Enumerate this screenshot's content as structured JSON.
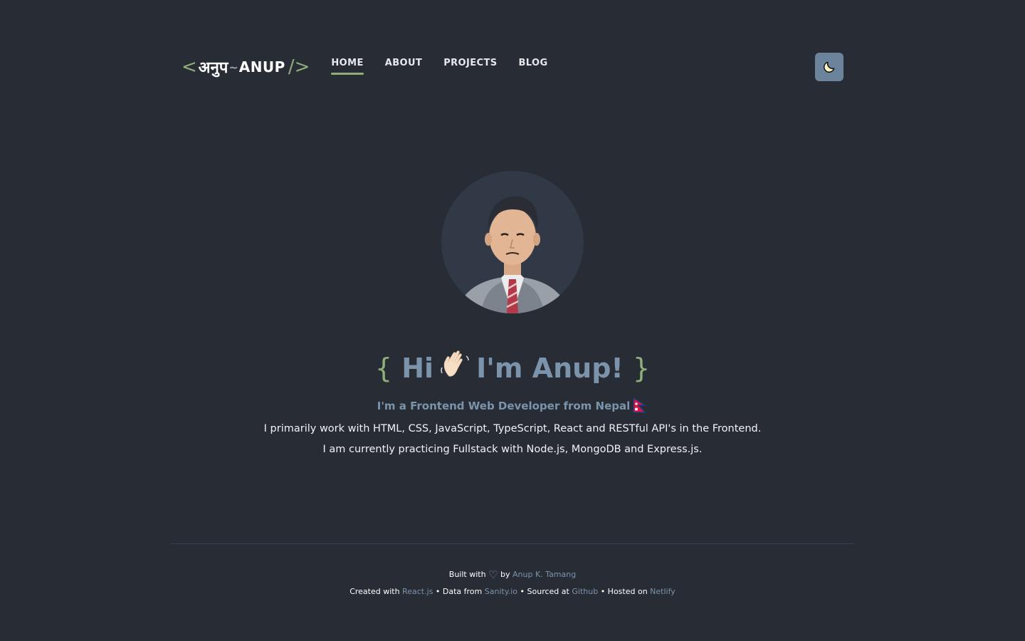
{
  "logo": {
    "open_bracket": "<",
    "devanagari": "अनुप",
    "tilde": "~",
    "latin": "ANUP",
    "close_bracket": "/>"
  },
  "nav": {
    "items": [
      {
        "label": "HOME",
        "active": true
      },
      {
        "label": "ABOUT",
        "active": false
      },
      {
        "label": "PROJECTS",
        "active": false
      },
      {
        "label": "BLOG",
        "active": false
      }
    ]
  },
  "theme_toggle": {
    "icon": "moon-icon"
  },
  "hero": {
    "avatar_icon": "profile-photo",
    "title_open": "{",
    "title_hi": "Hi",
    "wave_icon": "waving-hand-icon",
    "title_name": "I'm Anup!",
    "title_close": "}",
    "subtitle": "I'm a Frontend Web Developer from Nepal",
    "flag_icon": "nepal-flag-icon",
    "description_1": "I primarily work with HTML, CSS, JavaScript, TypeScript, React and RESTful API's in the Frontend.",
    "description_2": "I am currently practicing Fullstack with Node.js, MongoDB and Express.js."
  },
  "footer": {
    "built_with": "Built with",
    "heart": "♡",
    "by": "by",
    "author": "Anup K. Tamang",
    "created_with": "Created with",
    "created_with_link": "React.js",
    "data_from": "• Data from",
    "data_from_link": "Sanity.io",
    "sourced_at": "• Sourced at",
    "sourced_at_link": "Github",
    "hosted_on": "• Hosted on",
    "hosted_on_link": "Netlify"
  },
  "colors": {
    "background": "#282c35",
    "accent_green": "#8fae7a",
    "accent_blue": "#7b93ab",
    "toggle_bg": "#6b839b"
  }
}
